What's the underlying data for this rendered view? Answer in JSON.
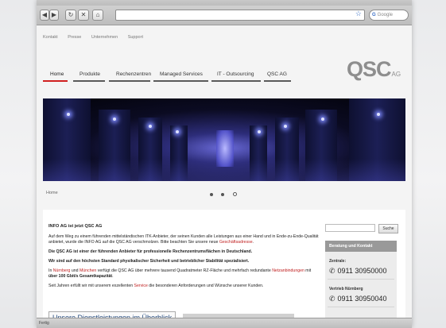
{
  "browser": {
    "search_placeholder": "Google",
    "status": "Fertig"
  },
  "meta_nav": [
    "Kontakt",
    "Presse",
    "Unternehmen",
    "Support"
  ],
  "main_nav": [
    {
      "label": "Home",
      "active": true
    },
    {
      "label": "Produkte",
      "active": false
    },
    {
      "label": "Rechenzentren",
      "active": false
    },
    {
      "label": "Managed Services",
      "active": false
    },
    {
      "label": "IT - Outsourcing",
      "active": false
    },
    {
      "label": "QSC AG",
      "active": false
    }
  ],
  "logo": {
    "text": "QSC",
    "suffix": "AG",
    "color": "#8e8e8e"
  },
  "slider": {
    "slide_count": 3,
    "current": 3
  },
  "breadcrumb": "Home",
  "article": {
    "heading": "INFO AG ist jetzt QSC AG",
    "p1_text": "Auf dem Weg zu einem führenden mittelständischen ITK-Anbieter, der seinen Kunden alle Leistungen aus einer Hand und in Ende-zu-Ende-Qualität anbietet, wurde die INFO AG auf die QSC AG verschmolzen. Bitte beachten Sie unsere neue ",
    "p1_link": "Geschäftsadresse",
    "p1_end": ".",
    "p2": "Die QSC AG ist einer der führenden Anbieter für professionelle Rechenzentrumsflächen in Deutschland.",
    "p3": "Wir sind auf den höchsten Standard physikalischer Sicherheit und betrieblicher Stabilität spezialisiert.",
    "p4_a": "In ",
    "p4_link1": "Nürnberg",
    "p4_b": " und ",
    "p4_link2": "München",
    "p4_c": " verfügt die QSC AG über mehrere tausend Quadratmeter RZ-Fläche und mehrfach redundante ",
    "p4_link3": "Netzanbindungen",
    "p4_d": " mit ",
    "p4_bold": "über 100 Gbit/s Gesamtkapazität",
    "p4_e": ".",
    "p5_a": "Seit Jahren erfüllt wir mit unserem exzellenten ",
    "p5_link": "Service",
    "p5_b": " die besonderen Anforderungen und Wünsche unserer Kunden.",
    "services_box": "Unsere Dienstleistungen im Überblick"
  },
  "sidebar": {
    "search_button": "Suche",
    "panel_title": "Beratung und Kontakt",
    "contacts": [
      {
        "label": "Zentrale:",
        "phone": "0911 30950000"
      },
      {
        "label": "Vertrieb Nürnberg",
        "phone": "0911 30950040"
      }
    ]
  },
  "colors": {
    "accent_red": "#d02020",
    "nav_bar": "#5a5a5a",
    "link_red": "#c02020"
  }
}
